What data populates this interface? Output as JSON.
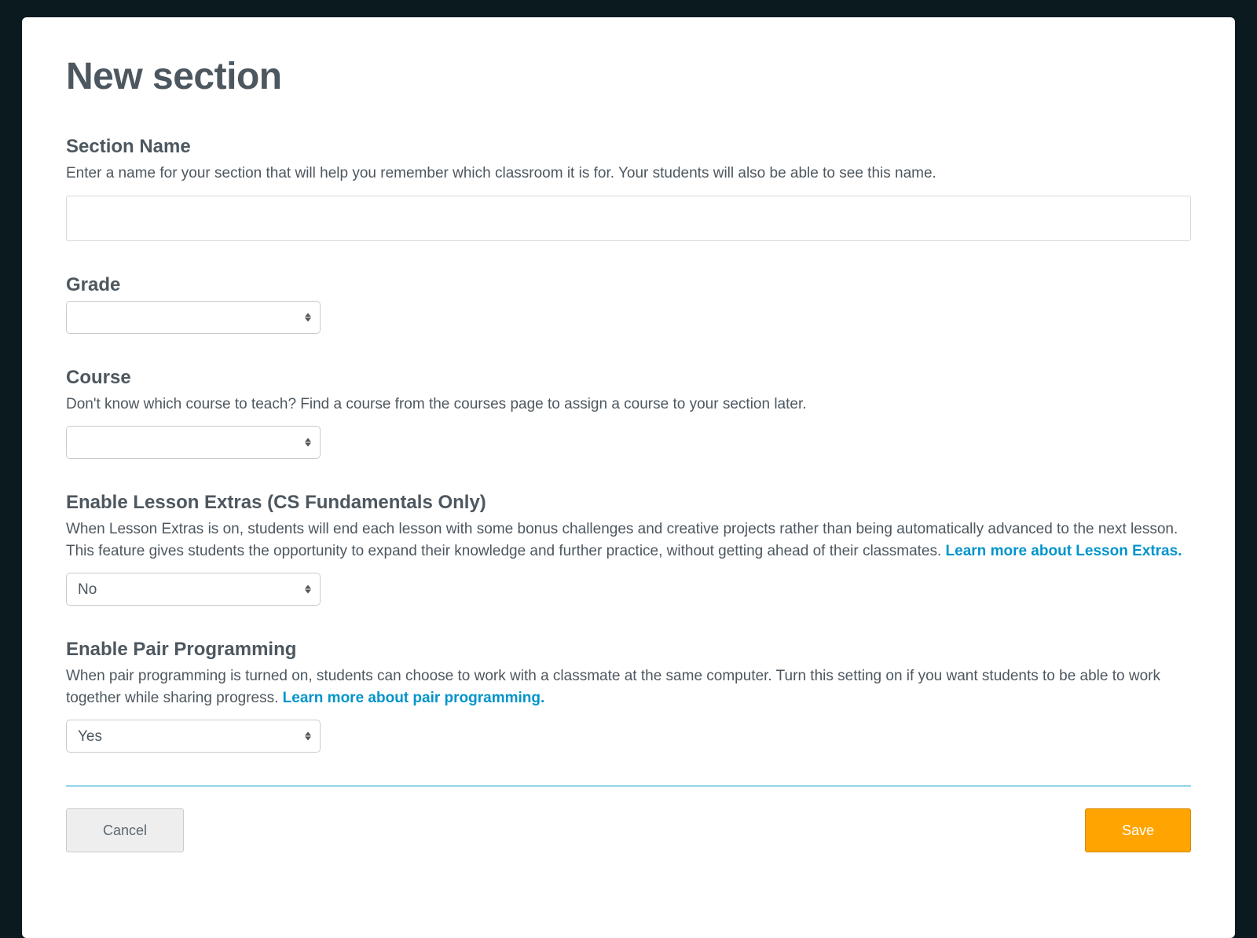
{
  "modal": {
    "title": "New section",
    "section_name": {
      "label": "Section Name",
      "description": "Enter a name for your section that will help you remember which classroom it is for. Your students will also be able to see this name.",
      "value": ""
    },
    "grade": {
      "label": "Grade",
      "value": ""
    },
    "course": {
      "label": "Course",
      "description": "Don't know which course to teach? Find a course from the courses page to assign a course to your section later.",
      "value": ""
    },
    "lesson_extras": {
      "label": "Enable Lesson Extras (CS Fundamentals Only)",
      "description_before": "When Lesson Extras is on, students will end each lesson with some bonus challenges and creative projects rather than being automatically advanced to the next lesson. This feature gives students the opportunity to expand their knowledge and further practice, without getting ahead of their classmates. ",
      "link_text": "Learn more about Lesson Extras.",
      "value": "No"
    },
    "pair_programming": {
      "label": "Enable Pair Programming",
      "description_before": "When pair programming is turned on, students can choose to work with a classmate at the same computer. Turn this setting on if you want students to be able to work together while sharing progress. ",
      "link_text": "Learn more about pair programming.",
      "value": "Yes"
    },
    "buttons": {
      "cancel": "Cancel",
      "save": "Save"
    }
  }
}
